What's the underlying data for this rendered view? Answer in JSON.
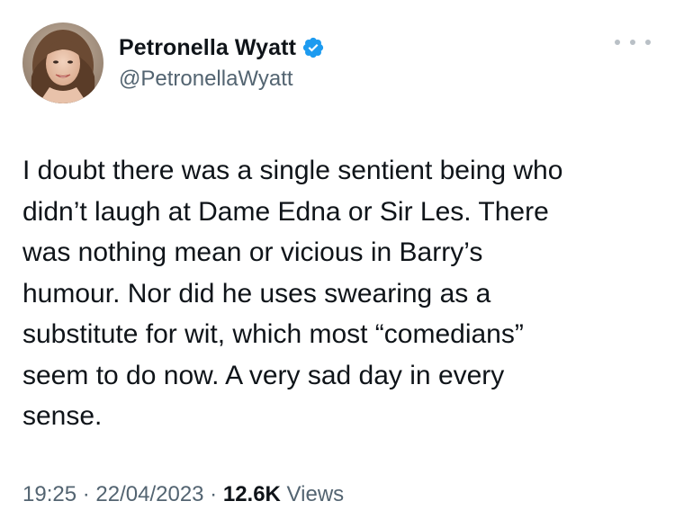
{
  "tweet": {
    "author": {
      "display_name": "Petronella Wyatt",
      "handle": "@PetronellaWyatt",
      "verified": true,
      "avatar_icon": "avatar-photo",
      "verified_icon": "verified-badge-icon",
      "verified_color": "#1d9bf0"
    },
    "more_icon": "more-options-icon",
    "text": "I doubt there was a single sentient being who\ndidn’t laugh at Dame Edna or Sir Les. There\nwas nothing mean or vicious in Barry’s\nhumour.  Nor did he uses swearing as a\nsubstitute for wit, which most “comedians”\nseem to do now.  A very sad day in every\nsense.",
    "meta": {
      "time": "19:25",
      "separator": " · ",
      "date": "22/04/2023",
      "views_count": "12.6K",
      "views_label": " Views"
    }
  }
}
